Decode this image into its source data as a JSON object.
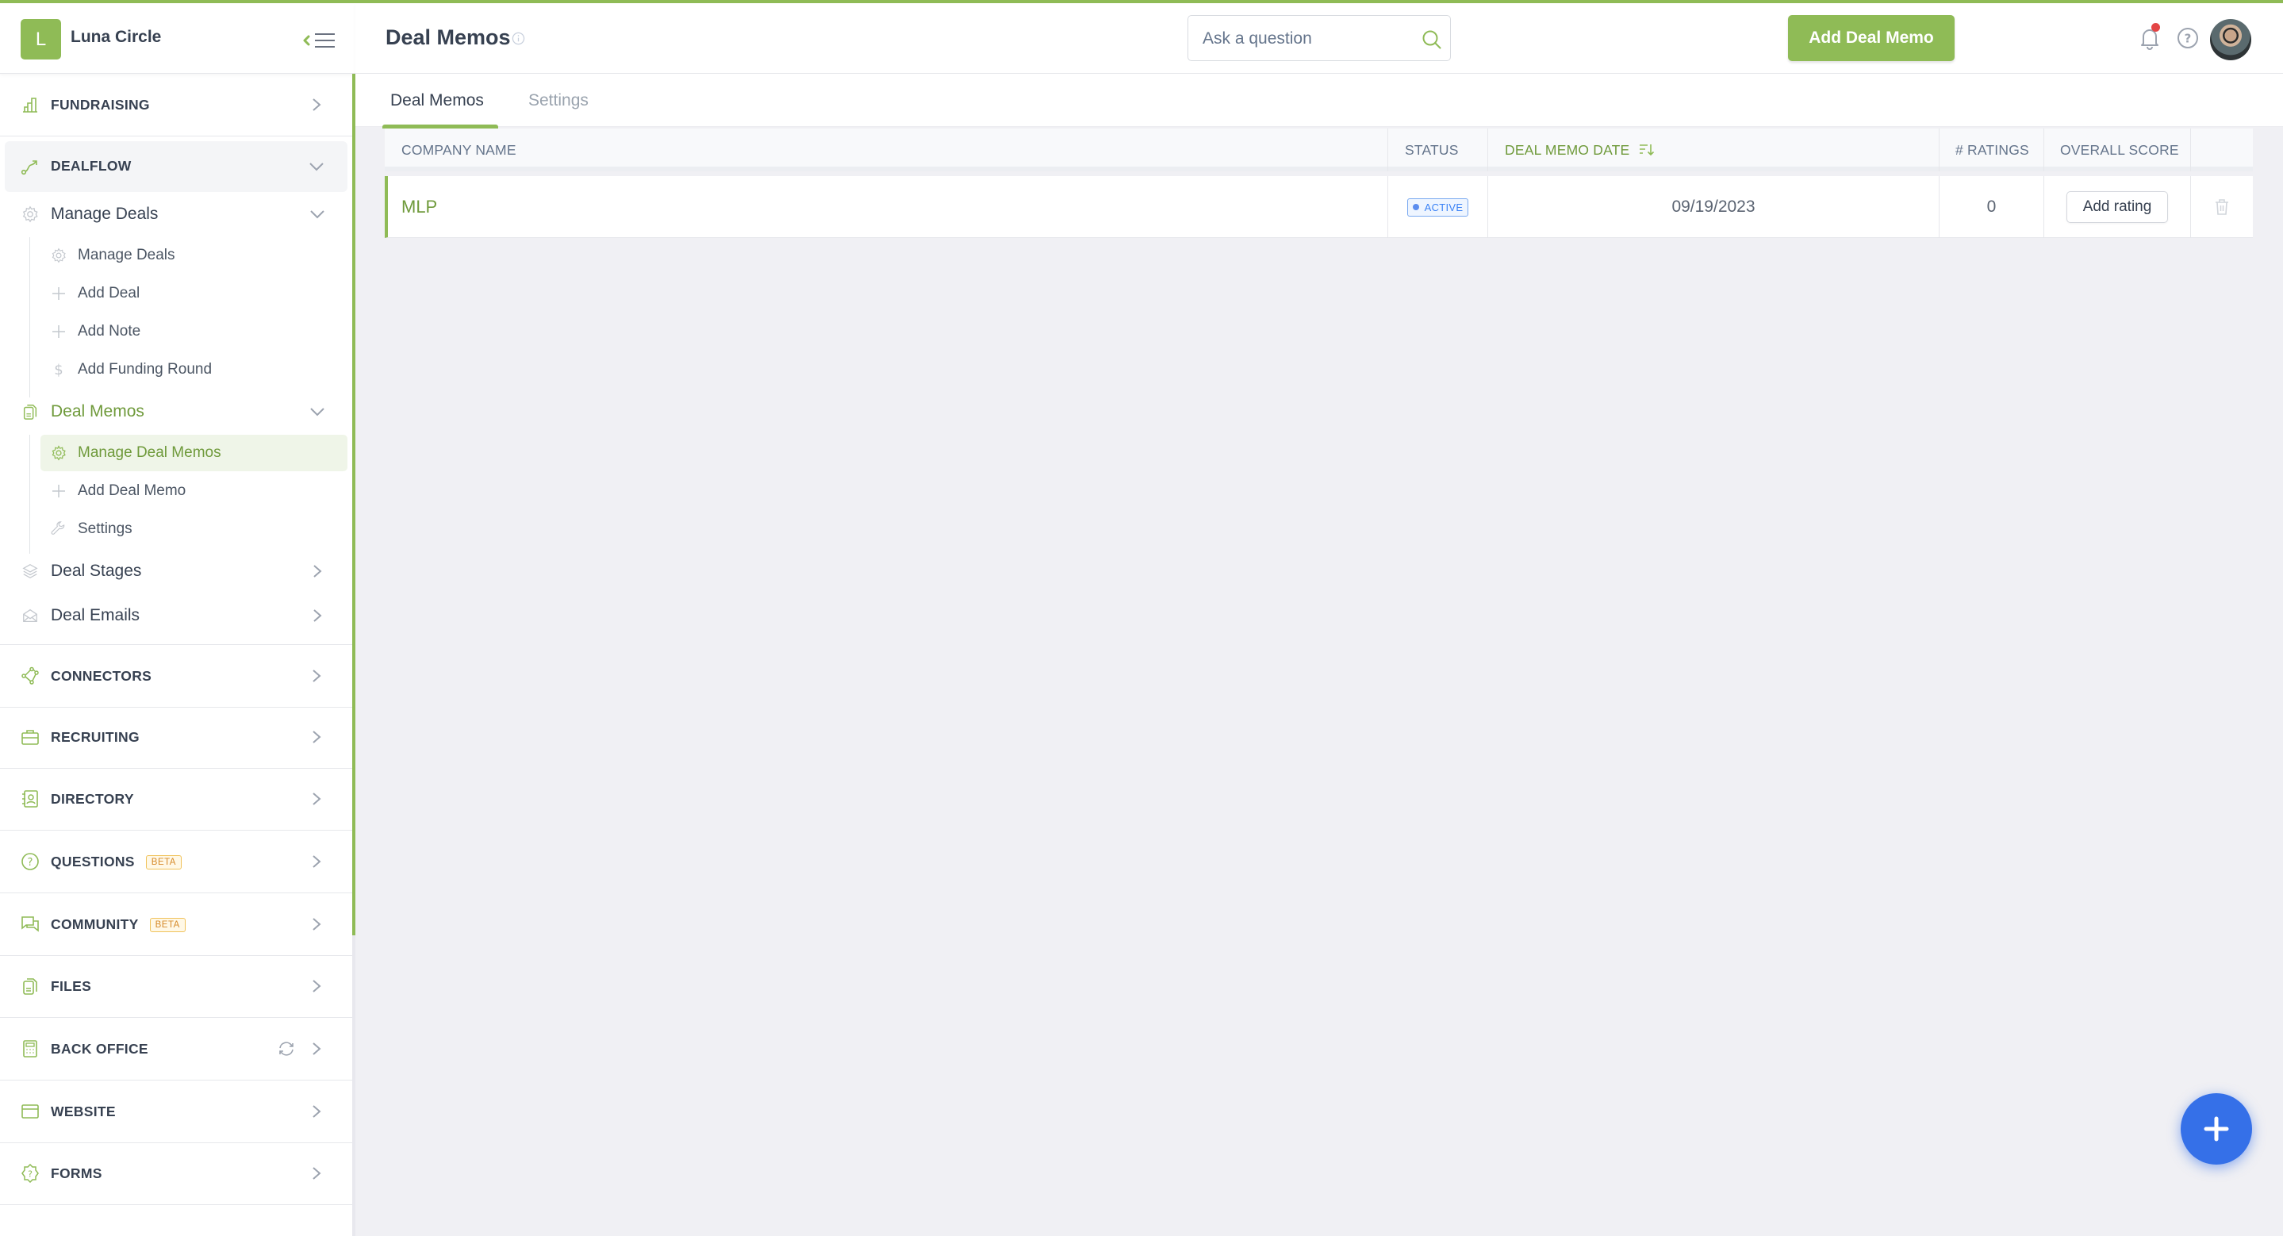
{
  "brand": {
    "initial": "L",
    "name": "Luna Circle"
  },
  "sidebar": {
    "sections": [
      {
        "label": "FUNDRAISING",
        "icon": "bar-chart-icon"
      },
      {
        "label": "DEALFLOW",
        "icon": "route-icon",
        "expanded": true
      },
      {
        "label": "CONNECTORS",
        "icon": "connectors-icon"
      },
      {
        "label": "RECRUITING",
        "icon": "briefcase-icon"
      },
      {
        "label": "DIRECTORY",
        "icon": "contact-book-icon"
      },
      {
        "label": "QUESTIONS",
        "icon": "question-circle-icon",
        "badge": "BETA"
      },
      {
        "label": "COMMUNITY",
        "icon": "chat-bubbles-icon",
        "badge": "BETA"
      },
      {
        "label": "FILES",
        "icon": "files-icon"
      },
      {
        "label": "BACK OFFICE",
        "icon": "calculator-icon"
      },
      {
        "label": "WEBSITE",
        "icon": "browser-window-icon"
      },
      {
        "label": "FORMS",
        "icon": "forms-badge-icon"
      }
    ],
    "dealflow": {
      "manage_deals": {
        "label": "Manage Deals",
        "children": [
          {
            "label": "Manage Deals",
            "icon": "gear-icon"
          },
          {
            "label": "Add Deal",
            "icon": "plus-icon"
          },
          {
            "label": "Add Note",
            "icon": "plus-icon"
          },
          {
            "label": "Add Funding Round",
            "icon": "dollar-icon"
          }
        ]
      },
      "deal_memos": {
        "label": "Deal Memos",
        "children": [
          {
            "label": "Manage Deal Memos",
            "icon": "gear-icon",
            "active": true
          },
          {
            "label": "Add Deal Memo",
            "icon": "plus-icon"
          },
          {
            "label": "Settings",
            "icon": "wrench-icon"
          }
        ]
      },
      "deal_stages": {
        "label": "Deal Stages"
      },
      "deal_emails": {
        "label": "Deal Emails"
      }
    }
  },
  "header": {
    "title": "Deal Memos",
    "search_placeholder": "Ask a question",
    "add_button": "Add Deal Memo",
    "has_notification": true
  },
  "tabs": [
    {
      "label": "Deal Memos",
      "active": true
    },
    {
      "label": "Settings",
      "active": false
    }
  ],
  "table": {
    "columns": [
      "COMPANY NAME",
      "STATUS",
      "DEAL MEMO DATE",
      "# RATINGS",
      "OVERALL SCORE",
      ""
    ],
    "sorted_column": "DEAL MEMO DATE",
    "rows": [
      {
        "company": "MLP",
        "status": "ACTIVE",
        "date": "09/19/2023",
        "ratings": "0",
        "score_action": "Add rating"
      }
    ]
  },
  "colors": {
    "brand_green": "#8fbb56",
    "text_green": "#6f9a3b",
    "fab_blue": "#3570e8",
    "status_blue": "#3b82f6",
    "notification_red": "#e34545",
    "beta_orange": "#d68a2a"
  }
}
